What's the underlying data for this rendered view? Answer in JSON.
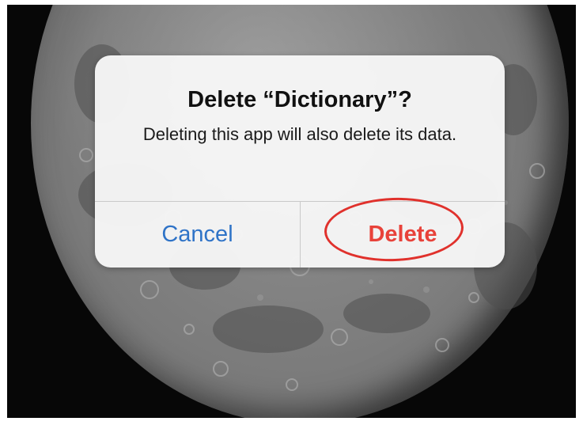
{
  "alert": {
    "title": "Delete “Dictionary”?",
    "message": "Deleting this app will also delete its data.",
    "buttons": {
      "cancel": "Cancel",
      "delete": "Delete"
    }
  },
  "colors": {
    "cancel_text": "#2f73c7",
    "delete_text": "#e8423a",
    "highlight_ring": "#e0312c",
    "wallpaper_background": "#070707"
  },
  "wallpaper": {
    "icon": "moon-icon"
  }
}
